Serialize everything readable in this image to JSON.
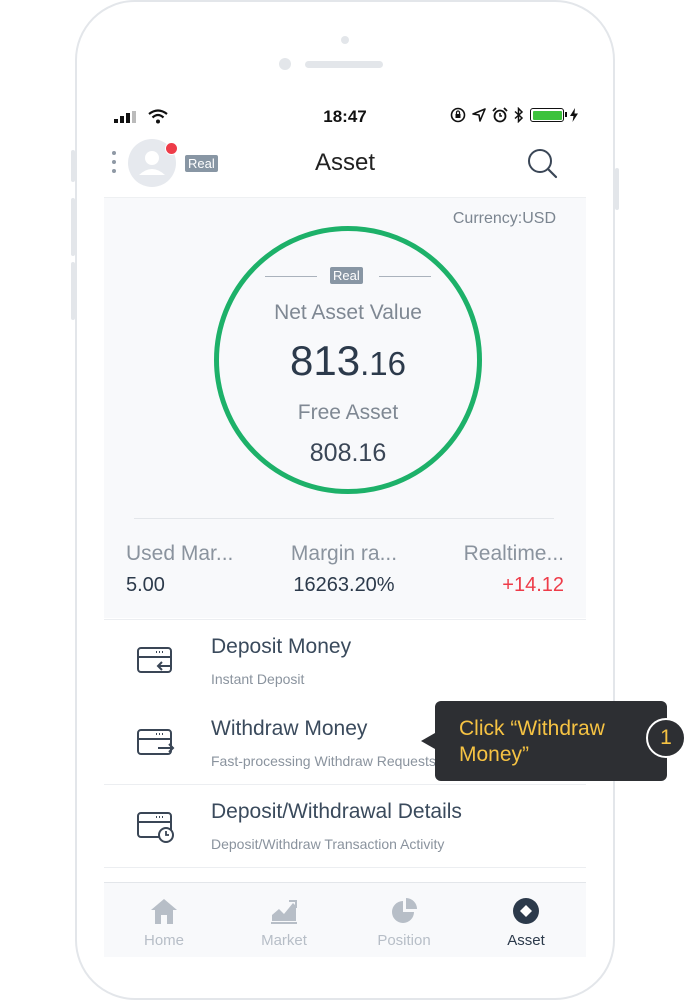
{
  "status_bar": {
    "time": "18:47"
  },
  "header": {
    "title": "Asset",
    "account_tag": "Real"
  },
  "asset": {
    "currency_label": "Currency:USD",
    "ring_tag": "Real",
    "net_asset_label": "Net Asset Value",
    "net_asset_int": "813",
    "net_asset_dec": ".16",
    "free_asset_label": "Free Asset",
    "free_asset_value": "808.16"
  },
  "stats": [
    {
      "label": "Used Mar...",
      "value": "5.00"
    },
    {
      "label": "Margin ra...",
      "value": "16263.20%"
    },
    {
      "label": "Realtime...",
      "value": "+14.12"
    }
  ],
  "menu": [
    {
      "title": "Deposit Money",
      "subtitle": "Instant Deposit"
    },
    {
      "title": "Withdraw Money",
      "subtitle": "Fast-processing Withdraw Requests"
    },
    {
      "title": "Deposit/Withdrawal Details",
      "subtitle": "Deposit/Withdraw Transaction Activity"
    }
  ],
  "tabs": [
    {
      "label": "Home",
      "icon": "home-icon"
    },
    {
      "label": "Market",
      "icon": "market-chart-icon"
    },
    {
      "label": "Position",
      "icon": "pie-chart-icon"
    },
    {
      "label": "Asset",
      "icon": "asset-diamond-icon"
    }
  ],
  "tooltip": {
    "text": "Click “Withdraw Money”",
    "step": "1"
  },
  "colors": {
    "ring": "#1db169",
    "positive": "#ee3c49",
    "tooltip_text": "#f6c343",
    "tooltip_bg": "#2d2f33",
    "tag_bg": "#8896a4"
  }
}
